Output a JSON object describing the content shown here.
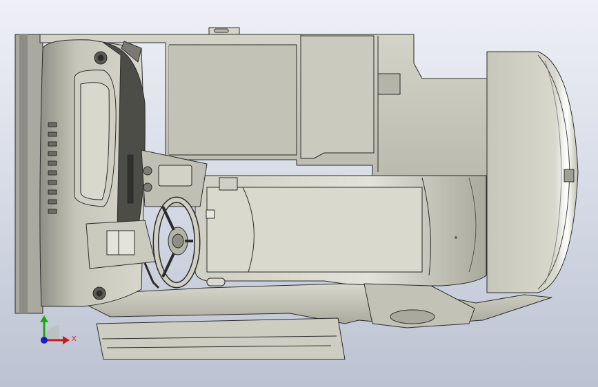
{
  "viewport": {
    "background_top": "#eef0f6",
    "background_bottom": "#bcc2d2",
    "model_body_color": "#c9c9bd",
    "model_edge_color": "#2b2b2b"
  },
  "triad": {
    "x_label": "X",
    "x_color": "#cc1a1a",
    "y_color": "#1aa61a",
    "z_color": "#1a1acc",
    "icon": "coordinate-triad-icon"
  }
}
